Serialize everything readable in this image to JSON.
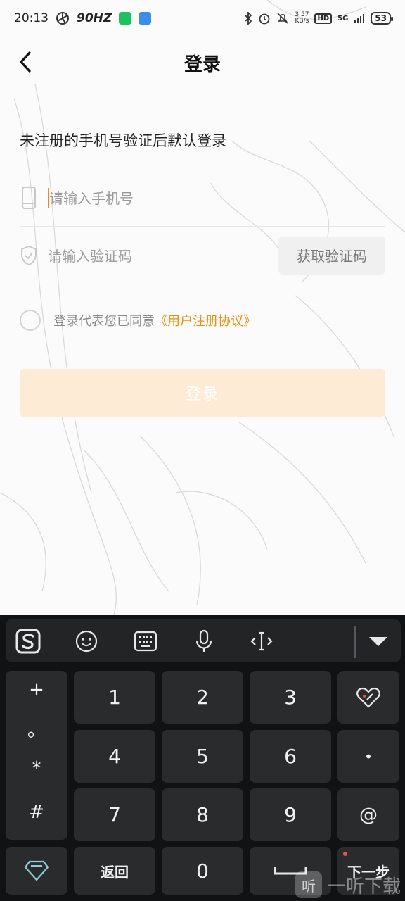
{
  "status_bar": {
    "time": "20:13",
    "refresh_rate": "90HZ",
    "net_speed_value": "3.57",
    "net_speed_unit": "KB/s",
    "hd": "HD",
    "network": "5G",
    "battery": "53"
  },
  "header": {
    "title": "登录"
  },
  "subtitle": "未注册的手机号验证后默认登录",
  "phone": {
    "placeholder": "请输入手机号"
  },
  "code": {
    "placeholder": "请输入验证码",
    "get_code_label": "获取验证码"
  },
  "agreement": {
    "text": "登录代表您已同意",
    "link": "《用户注册协议》"
  },
  "login_button": "登录",
  "keyboard": {
    "symbols": [
      "+",
      "。",
      "*",
      "#"
    ],
    "digits": [
      "1",
      "2",
      "3",
      "4",
      "5",
      "6",
      "7",
      "8",
      "9",
      "0"
    ],
    "dot": "•",
    "at": "@",
    "back_label": "返回",
    "next_label": "下一步"
  },
  "watermark": {
    "icon_text": "听",
    "text": "一听下载"
  },
  "colors": {
    "accent": "#e8900f",
    "login_disabled": "#fdebd6",
    "keyboard_bg": "#111213",
    "key_bg": "#2a2b2d"
  }
}
